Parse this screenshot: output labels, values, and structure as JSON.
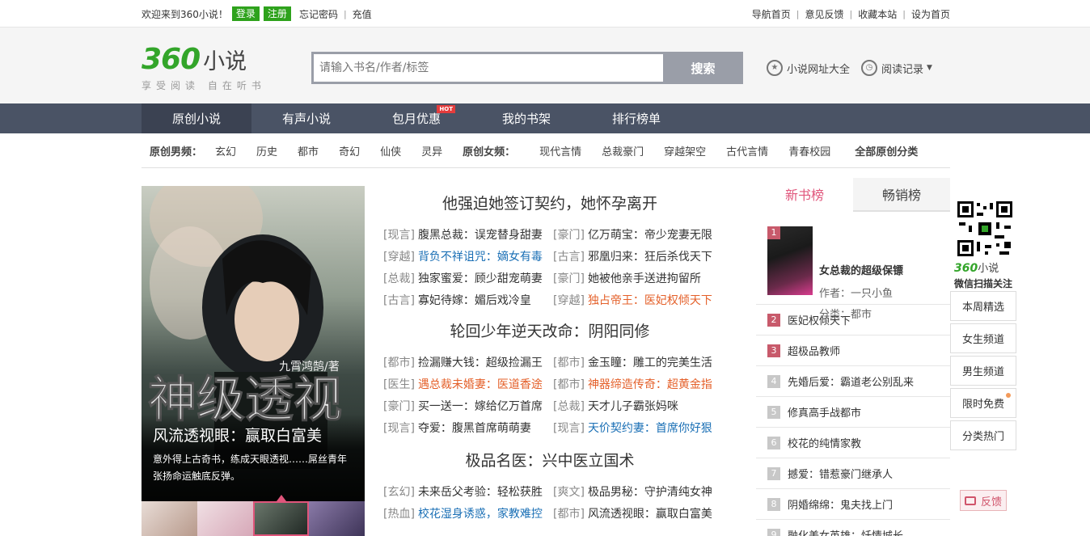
{
  "topbar": {
    "welcome": "欢迎来到360小说！",
    "login": "登录",
    "register": "注册",
    "forgot": "忘记密码",
    "recharge": "充值",
    "right_links": [
      "导航首页",
      "意见反馈",
      "收藏本站",
      "设为首页"
    ]
  },
  "header": {
    "logo_num": "360",
    "logo_cn": "小说",
    "slogan": "享受阅读 自在听书",
    "search_placeholder": "请输入书名/作者/标签",
    "search_btn": "搜索",
    "site_all": "小说网址大全",
    "history": "阅读记录"
  },
  "nav": {
    "items": [
      "原创小说",
      "有声小说",
      "包月优惠",
      "我的书架",
      "排行榜单"
    ],
    "hot_badge": "HOT"
  },
  "subnav": {
    "male_label": "原创男频：",
    "male": [
      "玄幻",
      "历史",
      "都市",
      "奇幻",
      "仙侠",
      "灵异"
    ],
    "female_label": "原创女频：",
    "female": [
      "现代言情",
      "总裁豪门",
      "穿越架空",
      "古代言情",
      "青春校园"
    ],
    "all": "全部原创分类"
  },
  "featured": {
    "cover_text": "神级透视",
    "cover_author": "九霄鸿鹄/著",
    "title": "风流透视眼：赢取白富美",
    "desc": "意外得上古奇书，练成天眼透视……屌丝青年张扬命运触底反弹。"
  },
  "blocks": [
    {
      "title": "他强迫她签订契约，她怀孕离开",
      "rows": [
        [
          {
            "tag": "[现言]",
            "text": "腹黑总裁：误宠替身甜妻",
            "c": "normal"
          },
          {
            "tag": "[豪门]",
            "text": "亿万萌宝：帝少宠妻无限",
            "c": "normal"
          }
        ],
        [
          {
            "tag": "[穿越]",
            "text": "背负不祥诅咒：嫡女有毒",
            "c": "blue"
          },
          {
            "tag": "[古言]",
            "text": "邪凰归来：狂后杀伐天下",
            "c": "normal"
          }
        ],
        [
          {
            "tag": "[总裁]",
            "text": "独家蜜爱：顾少甜宠萌妻",
            "c": "normal"
          },
          {
            "tag": "[豪门]",
            "text": "她被他亲手送进拘留所",
            "c": "normal"
          }
        ],
        [
          {
            "tag": "[古言]",
            "text": "寡妃待嫁：媚后戏冷皇",
            "c": "normal"
          },
          {
            "tag": "[穿越]",
            "text": "独占帝王：医妃权倾天下",
            "c": "orange"
          }
        ]
      ]
    },
    {
      "title": "轮回少年逆天改命：阴阳同修",
      "rows": [
        [
          {
            "tag": "[都市]",
            "text": "捡漏赚大钱：超级捡漏王",
            "c": "normal"
          },
          {
            "tag": "[都市]",
            "text": "金玉瞳：雕工的完美生活",
            "c": "normal"
          }
        ],
        [
          {
            "tag": "[医生]",
            "text": "遇总裁未婚妻：医道香途",
            "c": "orange"
          },
          {
            "tag": "[都市]",
            "text": "神器缔造传奇：超黄金指",
            "c": "orange"
          }
        ],
        [
          {
            "tag": "[豪门]",
            "text": "买一送一：嫁给亿万首席",
            "c": "normal"
          },
          {
            "tag": "[总裁]",
            "text": "天才儿子霸张妈咪",
            "c": "normal"
          }
        ],
        [
          {
            "tag": "[现言]",
            "text": "夺爱：腹黑首席萌萌妻",
            "c": "normal"
          },
          {
            "tag": "[现言]",
            "text": "天价契约妻：首席你好狠",
            "c": "blue"
          }
        ]
      ]
    },
    {
      "title": "极品名医：兴中医立国术",
      "rows": [
        [
          {
            "tag": "[玄幻]",
            "text": "未来岳父考验：轻松获胜",
            "c": "normal"
          },
          {
            "tag": "[爽文]",
            "text": "极品男秘：守护清纯女神",
            "c": "normal"
          }
        ],
        [
          {
            "tag": "[热血]",
            "text": "校花湿身诱惑，家教难控",
            "c": "blue"
          },
          {
            "tag": "[都市]",
            "text": "风流透视眼：赢取白富美",
            "c": "normal"
          }
        ]
      ]
    }
  ],
  "rank": {
    "tabs": [
      "新书榜",
      "畅销榜"
    ],
    "first": {
      "num": "1",
      "title": "女总裁的超级保镖",
      "author": "作者：一只小鱼",
      "category": "分类：都市"
    },
    "items": [
      {
        "num": "2",
        "title": "医妃权倾天下"
      },
      {
        "num": "3",
        "title": "超极品教师"
      },
      {
        "num": "4",
        "title": "先婚后爱：霸道老公别乱来"
      },
      {
        "num": "5",
        "title": "修真高手战都市"
      },
      {
        "num": "6",
        "title": "校花的纯情家教"
      },
      {
        "num": "7",
        "title": "撼爱：错惹豪门继承人"
      },
      {
        "num": "8",
        "title": "阴婚绵绵：鬼夫找上门"
      },
      {
        "num": "9",
        "title": "融化美女英雄：忏情城长"
      }
    ]
  },
  "float": {
    "qr_logo_num": "360",
    "qr_logo_cn": "小说",
    "qr_text": "微信扫描关注",
    "menu": [
      "本周精选",
      "女生频道",
      "男生频道",
      "限时免费",
      "分类热门"
    ],
    "feedback": "反馈"
  },
  "colors": {
    "green": "#2ea21c",
    "nav": "#4a5365",
    "accent": "#e0557b",
    "blue": "#1a6fb5",
    "orange": "#e4602a"
  }
}
